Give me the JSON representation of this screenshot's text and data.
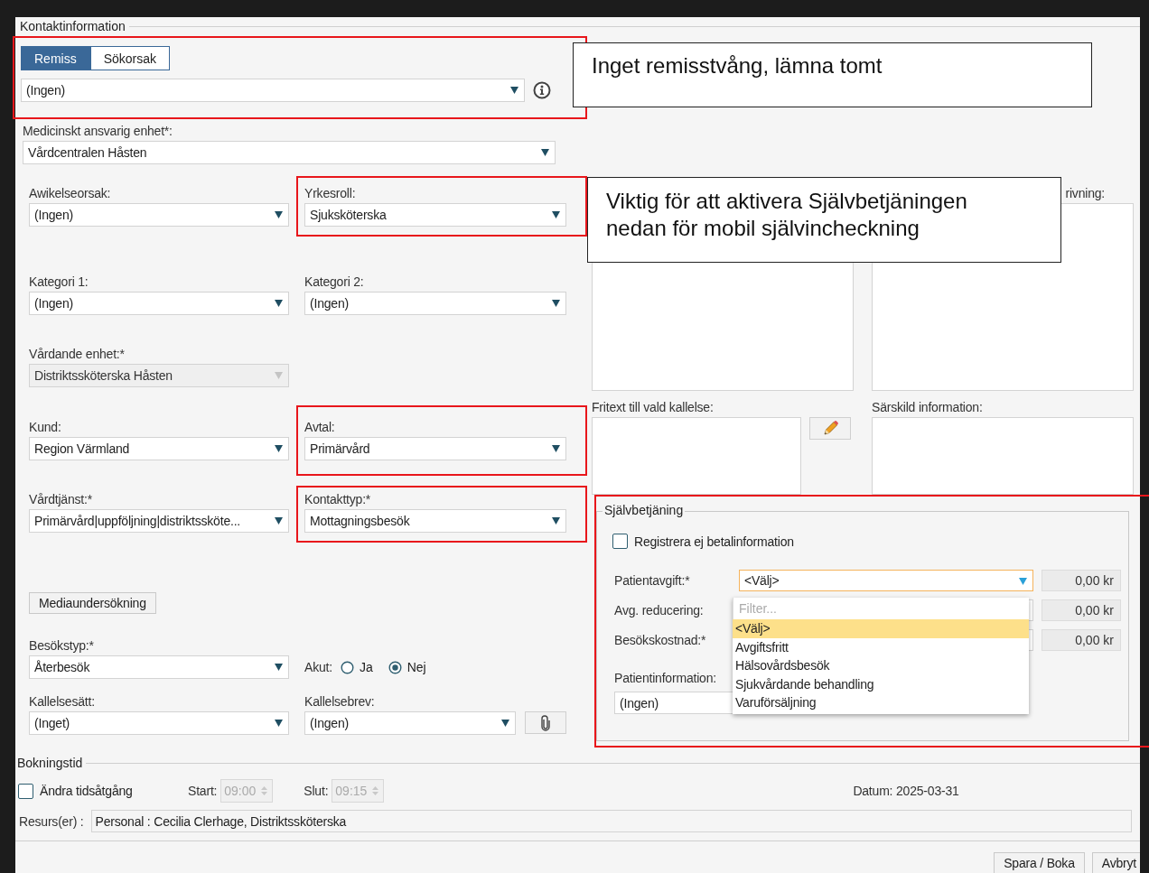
{
  "section_title": "Kontaktinformation",
  "referral_tabs": [
    {
      "label": "Remiss",
      "selected": true
    },
    {
      "label": "Sökorsak",
      "selected": false
    }
  ],
  "referral_select": {
    "value": "(Ingen)"
  },
  "responsible_unit": {
    "label": "Medicinskt ansvarig enhet*:",
    "value": "Vårdcentralen Håsten"
  },
  "form_rows": [
    {
      "cells": [
        {
          "kind": "select",
          "label": "Awikelseorsak:",
          "value": "(Ingen)",
          "disabled": false
        },
        {
          "kind": "select",
          "label": "Yrkesroll:",
          "value": "Sjuksköterska",
          "disabled": false
        }
      ]
    },
    {
      "cells": [
        {
          "kind": "select",
          "label": "Kategori 1:",
          "value": "(Ingen)",
          "disabled": false
        },
        {
          "kind": "select",
          "label": "Kategori 2:",
          "value": "(Ingen)",
          "disabled": false
        }
      ]
    },
    {
      "cells": [
        {
          "kind": "select",
          "label": "Vårdande enhet:*",
          "value": "Distriktssköterska Håsten",
          "disabled": true
        }
      ]
    },
    {
      "cells": [
        {
          "kind": "select",
          "label": "Kund:",
          "value": "Region Värmland",
          "disabled": false
        },
        {
          "kind": "select",
          "label": "Avtal:",
          "value": "Primärvård",
          "disabled": false
        }
      ]
    },
    {
      "cells": [
        {
          "kind": "select",
          "label": "Vårdtjänst:*",
          "value": "Primärvård|uppföljning|distriktssköte...",
          "disabled": false
        },
        {
          "kind": "select",
          "label": "Kontakttyp:*",
          "value": "Mottagningsbesök",
          "disabled": false
        }
      ]
    },
    {
      "cells": [
        {
          "kind": "button",
          "label": "Mediaundersökning"
        }
      ]
    },
    {
      "cells": [
        {
          "kind": "select",
          "label": "Besökstyp:*",
          "value": "Återbesök",
          "disabled": false
        },
        {
          "kind": "radio",
          "label": "Akut:",
          "options": [
            {
              "label": "Ja",
              "selected": false
            },
            {
              "label": "Nej",
              "selected": true
            }
          ]
        }
      ]
    },
    {
      "cells": [
        {
          "kind": "select",
          "label": "Kallelsesätt:",
          "value": "(Inget)",
          "disabled": false
        },
        {
          "kind": "select_attach",
          "label": "Kallelsebrev:",
          "value": "(Ingen)",
          "disabled": false
        }
      ]
    }
  ],
  "notes": {
    "description_label": "rivning:",
    "free_text_label": "Fritext till vald kallelse:",
    "special_info_label": "Särskild information:"
  },
  "self_service": {
    "title": "Självbetjäning",
    "no_payment": {
      "label": "Registrera ej betalinformation",
      "checked": false
    },
    "fee_rows": [
      {
        "label": "Patientavgift:*",
        "value": "<Välj>",
        "amount": "0,00 kr"
      },
      {
        "label": "Avg. reducering:",
        "amount": "0,00 kr"
      },
      {
        "label": "Besökskostnad:*",
        "amount": "0,00 kr"
      }
    ],
    "patient_info": {
      "label": "Patientinformation:",
      "value": "(Ingen)"
    },
    "dropdown": {
      "filter_placeholder": "Filter...",
      "options": [
        {
          "label": "<Välj>",
          "selected": true
        },
        {
          "label": "Avgiftsfritt",
          "selected": false
        },
        {
          "label": "Hälsovårdsbesök",
          "selected": false
        },
        {
          "label": "Sjukvårdande behandling",
          "selected": false
        },
        {
          "label": "Varuförsäljning",
          "selected": false
        }
      ]
    }
  },
  "booking": {
    "title": "Bokningstid",
    "change_duration": {
      "label": "Ändra tidsåtgång",
      "checked": false
    },
    "start": {
      "label": "Start:",
      "value": "09:00",
      "disabled": true
    },
    "end": {
      "label": "Slut:",
      "value": "09:15",
      "disabled": true
    },
    "date": "Datum: 2025-03-31",
    "resources_label": "Resurs(er) :",
    "resources_value": "Personal : Cecilia Clerhage, Distriktssköterska"
  },
  "buttons": [
    "Spara / Boka",
    "Avbryt"
  ],
  "callouts": [
    {
      "text": "Inget remisstvång, lämna tomt"
    },
    {
      "text": "Viktig för att aktivera Självbetjäningen nedan för mobil självincheckning"
    }
  ]
}
